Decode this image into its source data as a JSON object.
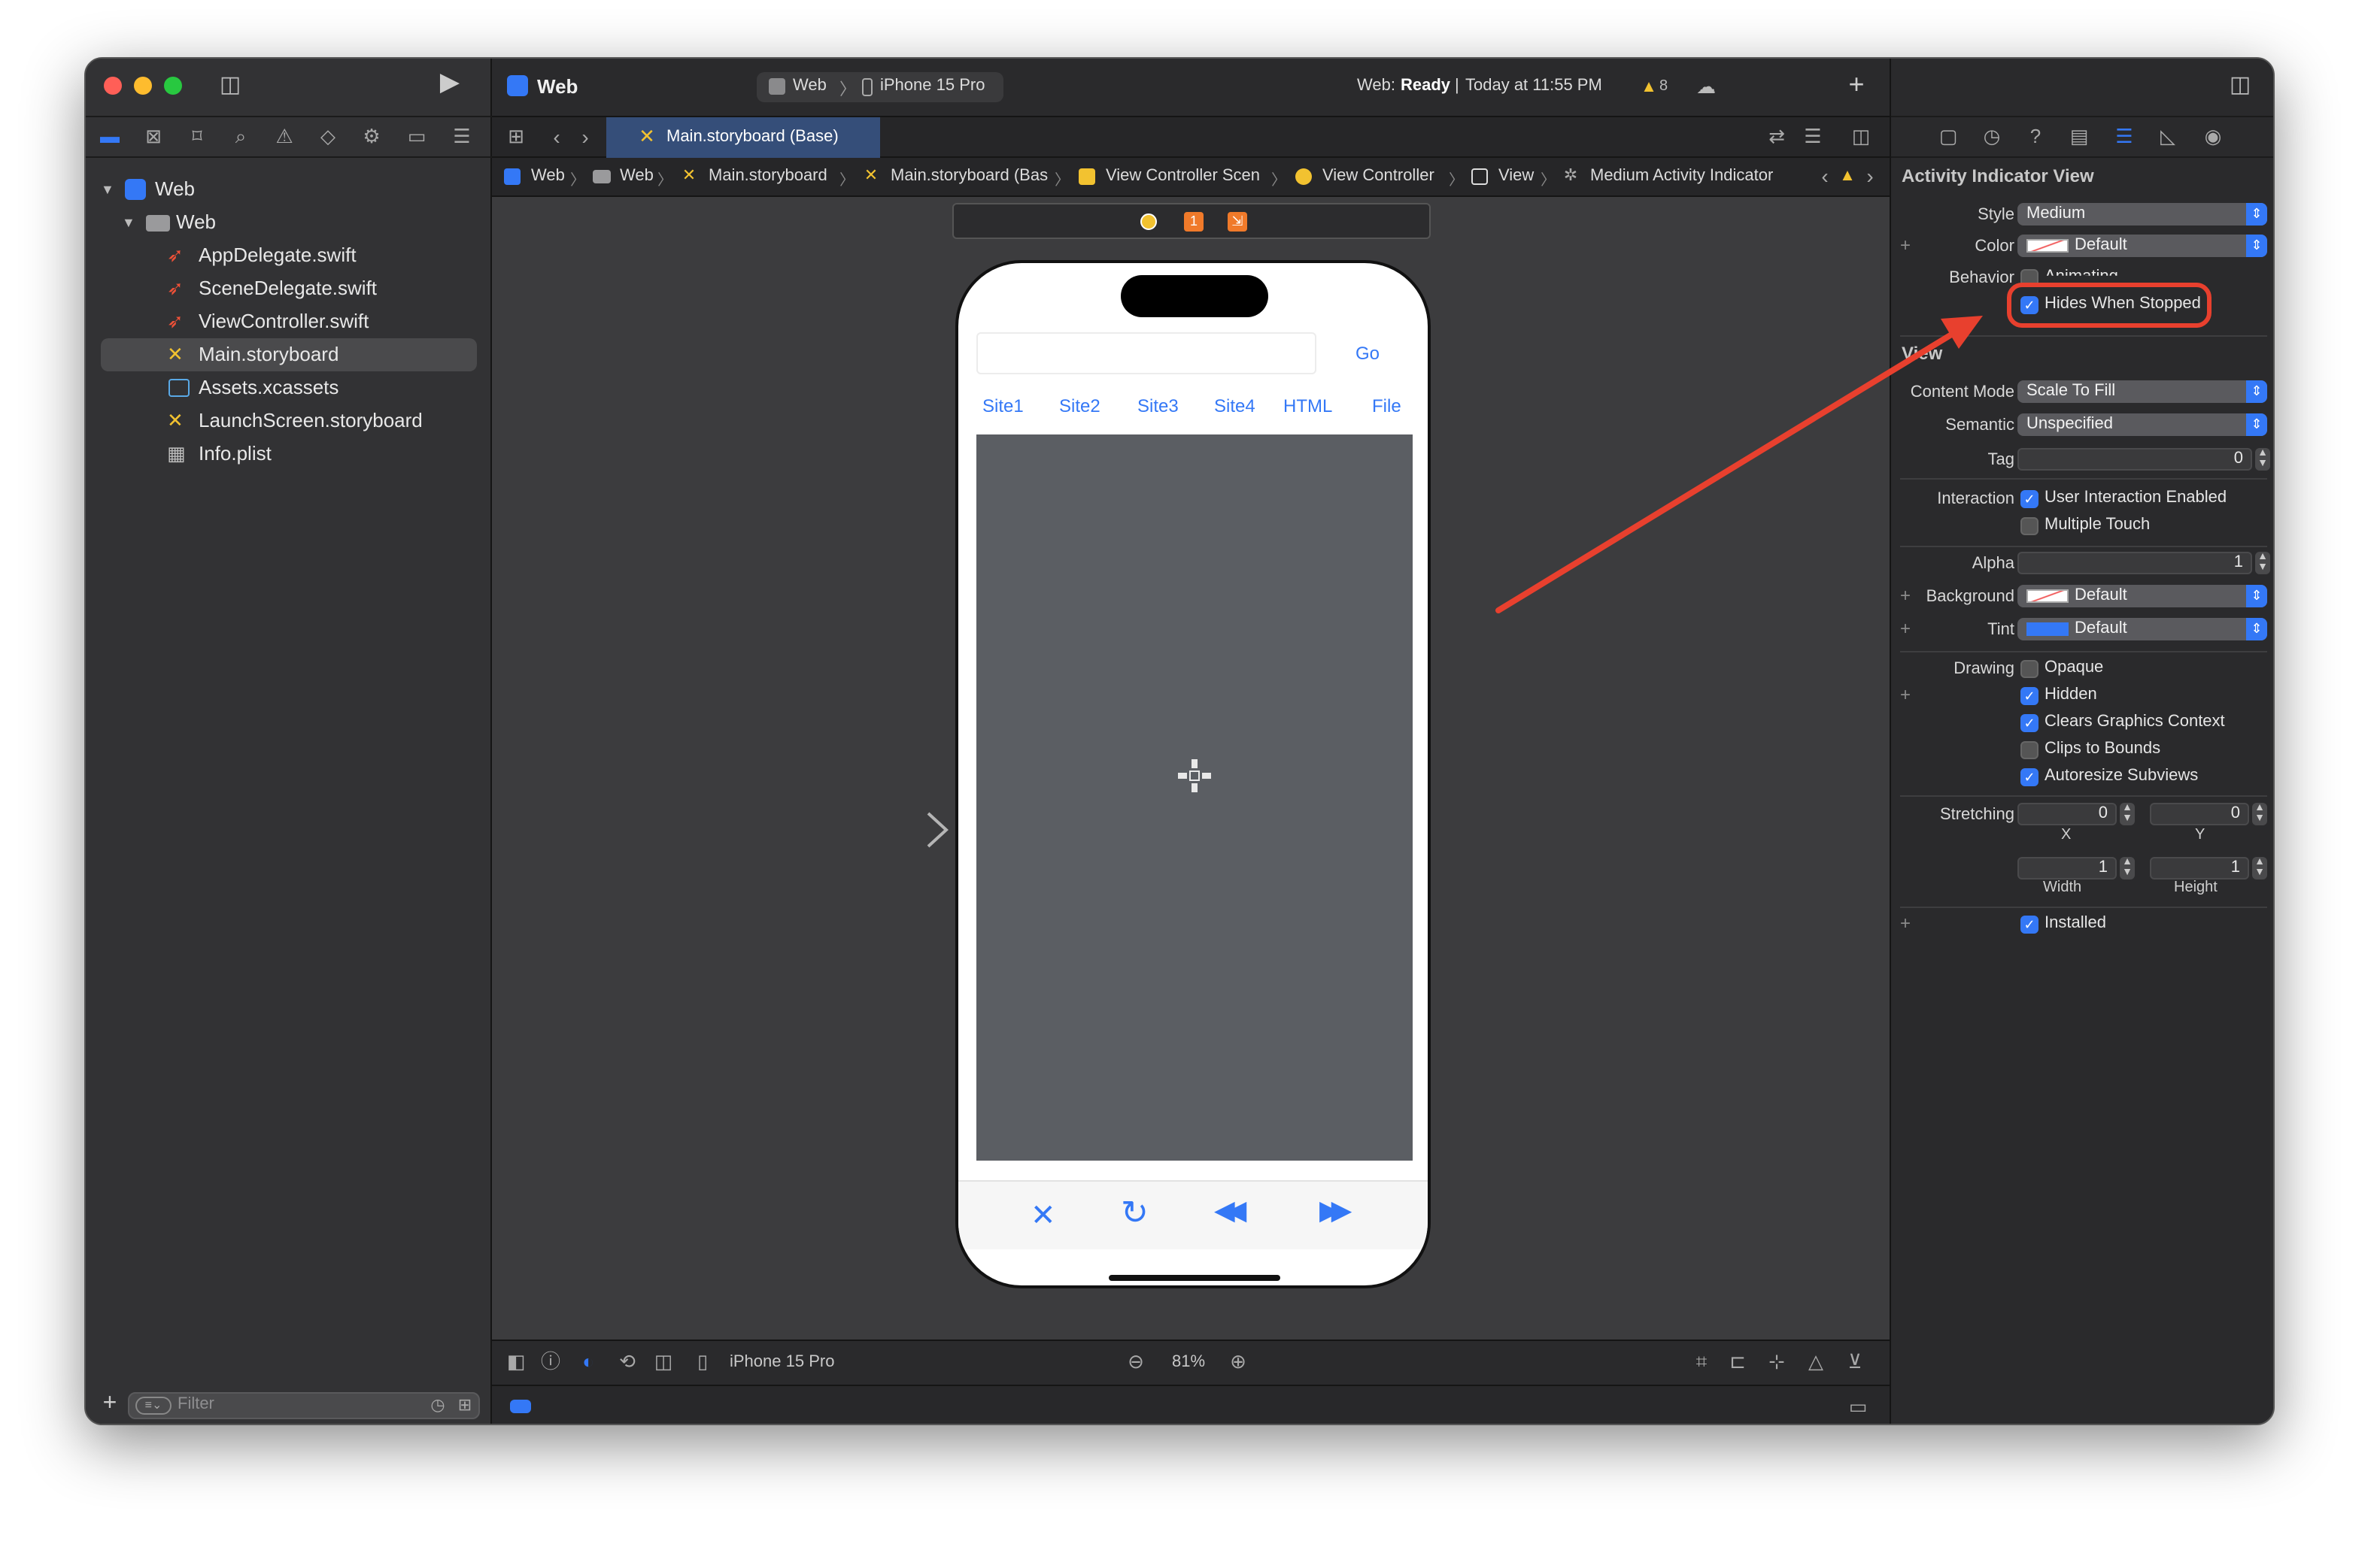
{
  "window": {
    "project_name": "Web",
    "scheme": "Web",
    "device": "iPhone 15 Pro",
    "status_prefix": "Web:",
    "status_state": "Ready",
    "status_time": "Today at 11:55 PM",
    "warning_count": "8"
  },
  "navigator": {
    "items": [
      {
        "label": "Web",
        "level": 0,
        "icon": "project-icon"
      },
      {
        "label": "Web",
        "level": 1,
        "icon": "folder-icon"
      },
      {
        "label": "AppDelegate.swift",
        "level": 2,
        "icon": "swift-file-icon"
      },
      {
        "label": "SceneDelegate.swift",
        "level": 2,
        "icon": "swift-file-icon"
      },
      {
        "label": "ViewController.swift",
        "level": 2,
        "icon": "swift-file-icon"
      },
      {
        "label": "Main.storyboard",
        "level": 2,
        "icon": "storyboard-icon",
        "selected": true
      },
      {
        "label": "Assets.xcassets",
        "level": 2,
        "icon": "assets-icon"
      },
      {
        "label": "LaunchScreen.storyboard",
        "level": 2,
        "icon": "storyboard-icon"
      },
      {
        "label": "Info.plist",
        "level": 2,
        "icon": "plist-icon"
      }
    ],
    "filter_placeholder": "Filter"
  },
  "editor": {
    "active_tab": "Main.storyboard (Base)",
    "jump_bar": [
      "Web",
      "Web",
      "Main.storyboard",
      "Main.storyboard (Bas",
      "View Controller Scen",
      "View Controller",
      "View",
      "Medium Activity Indicator"
    ],
    "scene_badges": [
      "1",
      "⇲"
    ]
  },
  "phone": {
    "go_label": "Go",
    "site_links": [
      "Site1",
      "Site2",
      "Site3",
      "Site4",
      "HTML",
      "File"
    ]
  },
  "bottom_bar": {
    "device": "iPhone 15 Pro",
    "zoom": "81%"
  },
  "inspector": {
    "section_title": "Activity Indicator View",
    "style_label": "Style",
    "style_value": "Medium",
    "color_label": "Color",
    "color_value": "Default",
    "behavior_label": "Behavior",
    "animating_label": "Animating",
    "hides_when_stopped_label": "Hides When Stopped",
    "view_section_title": "View",
    "content_mode_label": "Content Mode",
    "content_mode_value": "Scale To Fill",
    "semantic_label": "Semantic",
    "semantic_value": "Unspecified",
    "tag_label": "Tag",
    "tag_value": "0",
    "interaction_label": "Interaction",
    "user_interaction_label": "User Interaction Enabled",
    "multiple_touch_label": "Multiple Touch",
    "alpha_label": "Alpha",
    "alpha_value": "1",
    "background_label": "Background",
    "background_value": "Default",
    "tint_label": "Tint",
    "tint_value": "Default",
    "drawing_label": "Drawing",
    "opaque_label": "Opaque",
    "hidden_label": "Hidden",
    "clears_graphics_label": "Clears Graphics Context",
    "clips_to_bounds_label": "Clips to Bounds",
    "autoresize_label": "Autoresize Subviews",
    "stretching_label": "Stretching",
    "stretch_x": "0",
    "stretch_y": "0",
    "stretch_x_label": "X",
    "stretch_y_label": "Y",
    "stretch_width": "1",
    "stretch_height": "1",
    "stretch_width_label": "Width",
    "stretch_height_label": "Height",
    "installed_label": "Installed"
  },
  "colors": {
    "accent": "#3478f6",
    "annotation_red": "#e8402e"
  }
}
